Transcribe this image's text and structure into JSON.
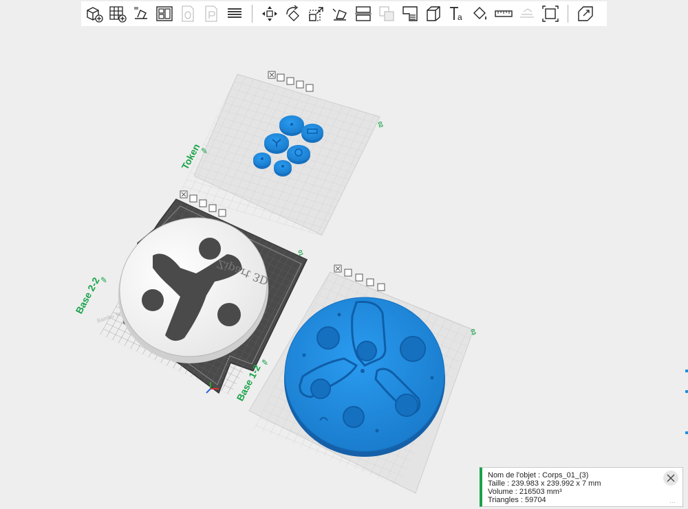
{
  "toolbar": {
    "buttons": [
      {
        "icon": "add-cube-icon",
        "enabled": true
      },
      {
        "icon": "add-plate-grid-icon",
        "enabled": true
      },
      {
        "icon": "auto-orient-icon",
        "enabled": true
      },
      {
        "icon": "arrange-icon",
        "enabled": true
      },
      {
        "icon": "plate-0-icon",
        "enabled": false
      },
      {
        "icon": "plate-p-icon",
        "enabled": false
      },
      {
        "icon": "layers-icon",
        "enabled": true
      },
      {
        "icon": "move-icon",
        "enabled": true
      },
      {
        "icon": "rotate-icon",
        "enabled": true
      },
      {
        "icon": "scale-icon",
        "enabled": true
      },
      {
        "icon": "lay-on-face-icon",
        "enabled": true
      },
      {
        "icon": "cut-icon",
        "enabled": true
      },
      {
        "icon": "boolean-icon",
        "enabled": false
      },
      {
        "icon": "support-paint-icon",
        "enabled": true
      },
      {
        "icon": "seam-paint-icon",
        "enabled": true
      },
      {
        "icon": "text-emboss-icon",
        "enabled": true
      },
      {
        "icon": "color-paint-icon",
        "enabled": true
      },
      {
        "icon": "measure-icon",
        "enabled": true
      },
      {
        "icon": "assembly-icon",
        "enabled": false
      },
      {
        "icon": "fit-view-icon",
        "enabled": true
      },
      {
        "icon": "split-parts-icon",
        "enabled": true
      }
    ]
  },
  "plates": [
    {
      "name": "Token",
      "number": "02"
    },
    {
      "name": "Base 2-2",
      "number": "01"
    },
    {
      "name": "Base 1-2",
      "number": "03"
    }
  ],
  "scene": {
    "engraved_text": "Zipart 3D",
    "texture_label": "Bambu Textured"
  },
  "colors": {
    "accent": "#19a34a",
    "model_blue": "#1e8fe0",
    "background": "#eeeeee"
  },
  "info": {
    "name_line": "Nom de l'objet : Corps_01_(3)",
    "size_line": "Taille : 239.983 x 239.992 x 7 mm",
    "volume_line": "Volume : 216503 mm³",
    "triangles_line": "Triangles : 59704",
    "more_glyph": "…"
  }
}
